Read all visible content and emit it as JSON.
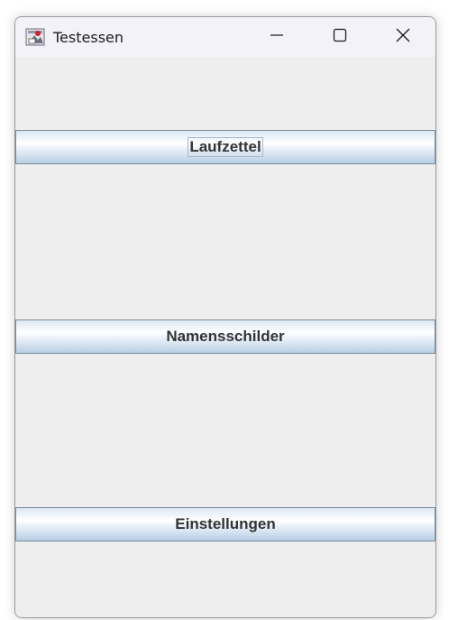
{
  "window": {
    "title": "Testessen",
    "app_icon": "java-app-icon"
  },
  "title_controls": {
    "minimize_icon": "minimize-icon",
    "maximize_icon": "maximize-icon",
    "close_icon": "close-icon"
  },
  "buttons": [
    {
      "label": "Laufzettel",
      "focused": true
    },
    {
      "label": "Namensschilder",
      "focused": false
    },
    {
      "label": "Einstellungen",
      "focused": false
    }
  ],
  "colors": {
    "window_bg": "#eeeeee",
    "titlebar_bg": "#f3f2f9",
    "button_border": "#7a8a99",
    "button_text": "#333333"
  }
}
